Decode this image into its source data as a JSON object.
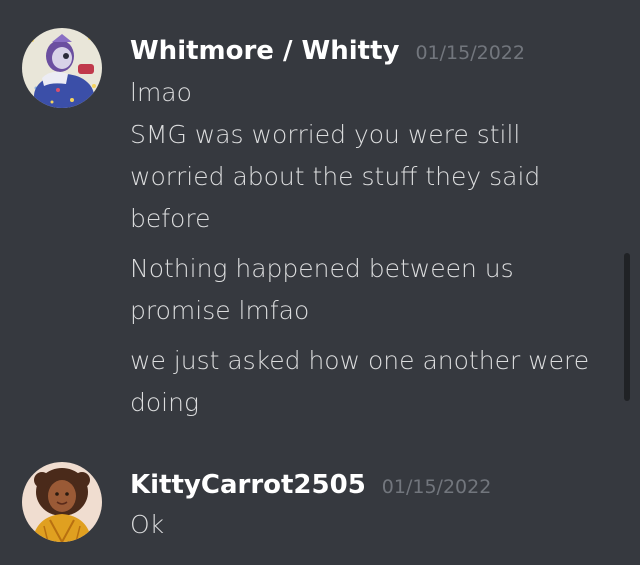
{
  "chat": {
    "messages": [
      {
        "author": "Whitmore / Whitty",
        "timestamp": "01/15/2022",
        "avatar_icon": "avatar-whitmore-icon",
        "lines": [
          "lmao",
          "SMG was worried you were still worried about the stuff they said before",
          "Nothing happened between us promise lmfao",
          "we just asked how one another were doing"
        ]
      },
      {
        "author": "KittyCarrot2505",
        "timestamp": "01/15/2022",
        "avatar_icon": "avatar-kittycarrot-icon",
        "lines": [
          "Ok"
        ]
      }
    ]
  },
  "colors": {
    "background": "#36393f",
    "username": "#ffffff",
    "timestamp": "#72767d",
    "message_text": "#dcddde",
    "scrollbar": "#202225"
  }
}
